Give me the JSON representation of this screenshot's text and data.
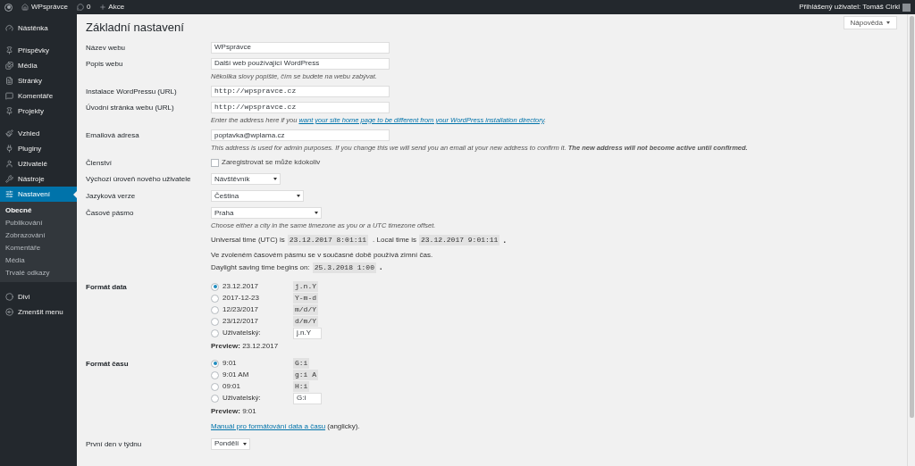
{
  "admin_bar": {
    "site": "WPsprávce",
    "comments": "0",
    "new": "Akce",
    "user": "Přihlášený uživatel: Tomáš Cirkl"
  },
  "help_button": "Nápověda",
  "sidebar": {
    "groups": [
      {
        "items": [
          {
            "label": "Nástěnka",
            "selected": false
          }
        ]
      },
      {
        "items": [
          {
            "label": "Příspěvky",
            "selected": false
          },
          {
            "label": "Média",
            "selected": false
          },
          {
            "label": "Stránky",
            "selected": false
          },
          {
            "label": "Komentáře",
            "selected": false
          },
          {
            "label": "Projekty",
            "selected": false
          }
        ]
      },
      {
        "items": [
          {
            "label": "Vzhled",
            "selected": false
          },
          {
            "label": "Pluginy",
            "selected": false
          },
          {
            "label": "Uživatelé",
            "selected": false
          },
          {
            "label": "Nástroje",
            "selected": false
          },
          {
            "label": "Nastavení",
            "selected": true,
            "children": [
              {
                "label": "Obecné",
                "selected": true
              },
              {
                "label": "Publikování",
                "selected": false
              },
              {
                "label": "Zobrazování",
                "selected": false
              },
              {
                "label": "Komentáře",
                "selected": false
              },
              {
                "label": "Média",
                "selected": false
              },
              {
                "label": "Trvalé odkazy",
                "selected": false
              }
            ]
          }
        ]
      },
      {
        "items": [
          {
            "label": "Divi",
            "selected": false
          },
          {
            "label": "Zmenšit menu",
            "selected": false
          }
        ]
      }
    ]
  },
  "page_title": "Základní nastavení",
  "rows": [
    {
      "kind": "text",
      "label": "Název webu",
      "value": "WPsprávce"
    },
    {
      "kind": "text",
      "label": "Popis webu",
      "value": "Další web používající WordPress",
      "description": "Několika slovy popište, čím se budete na webu zabývat."
    },
    {
      "kind": "url",
      "label": "Instalace WordPressu (URL)",
      "value": "http://wpspravce.cz"
    },
    {
      "kind": "url",
      "label": "Úvodní stránka webu (URL)",
      "value": "http://wpspravce.cz",
      "description": "Enter the address here if you ",
      "description_link": "want your site home page to be different from your WordPress installation directory",
      "description_after": "."
    },
    {
      "kind": "text",
      "label": "Emailová adresa",
      "value": "poptavka@wplama.cz",
      "description": "This address is used for admin purposes. If you change this we will send you an email at your new address to confirm it. **The new address will not become active until confirmed.**"
    },
    {
      "kind": "checkbox",
      "label": "Členství",
      "option": "Zaregistrovat se může kdokoliv",
      "checked": false
    },
    {
      "kind": "select",
      "label": "Výchozí úroveň nového uživatele",
      "value": "Návštěvník"
    },
    {
      "kind": "select",
      "label": "Jazyková verze",
      "value": "Čeština"
    },
    {
      "kind": "timezone",
      "label": "Časové pásmo",
      "value": "Praha",
      "description": "Choose either a city in the same timezone as you or a UTC timezone offset.",
      "utc_label": "Universal time (UTC) is",
      "utc": "23.12.2017 8:01:11",
      "local_label": ". Local time is",
      "local": "23.12.2017 9:01:11",
      "end": ".",
      "dst_note": "Ve zvoleném časovém pásmu se v současné době používá zimní čas.",
      "dst_label": "Daylight saving time begins on:",
      "dst": "25.3.2018 1:00",
      "dst_end": "."
    },
    {
      "kind": "radio",
      "label": "Formát data",
      "options": [
        {
          "label": "23.12.2017",
          "format": "j.n.Y",
          "selected": true
        },
        {
          "label": "2017-12-23",
          "format": "Y-m-d",
          "selected": false
        },
        {
          "label": "12/23/2017",
          "format": "m/d/Y",
          "selected": false
        },
        {
          "label": "23/12/2017",
          "format": "d/m/Y",
          "selected": false
        },
        {
          "label": "Uživatelský:",
          "custom": "j.n.Y",
          "selected": false
        }
      ],
      "preview": "**Preview:** 23.12.2017"
    },
    {
      "kind": "radio",
      "label": "Formát času",
      "options": [
        {
          "label": "9:01",
          "format": "G:i",
          "selected": true
        },
        {
          "label": "9:01 AM",
          "format": "g:i A",
          "selected": false
        },
        {
          "label": "09:01",
          "format": "H:i",
          "selected": false
        },
        {
          "label": "Uživatelský:",
          "custom": "G:i",
          "selected": false
        }
      ],
      "preview": "**Preview:** 9:01",
      "link": "Manuál pro formátování data a času",
      "link_after": " (anglicky)."
    },
    {
      "kind": "select",
      "label": "První den v týdnu",
      "value": "Pondělí"
    }
  ]
}
